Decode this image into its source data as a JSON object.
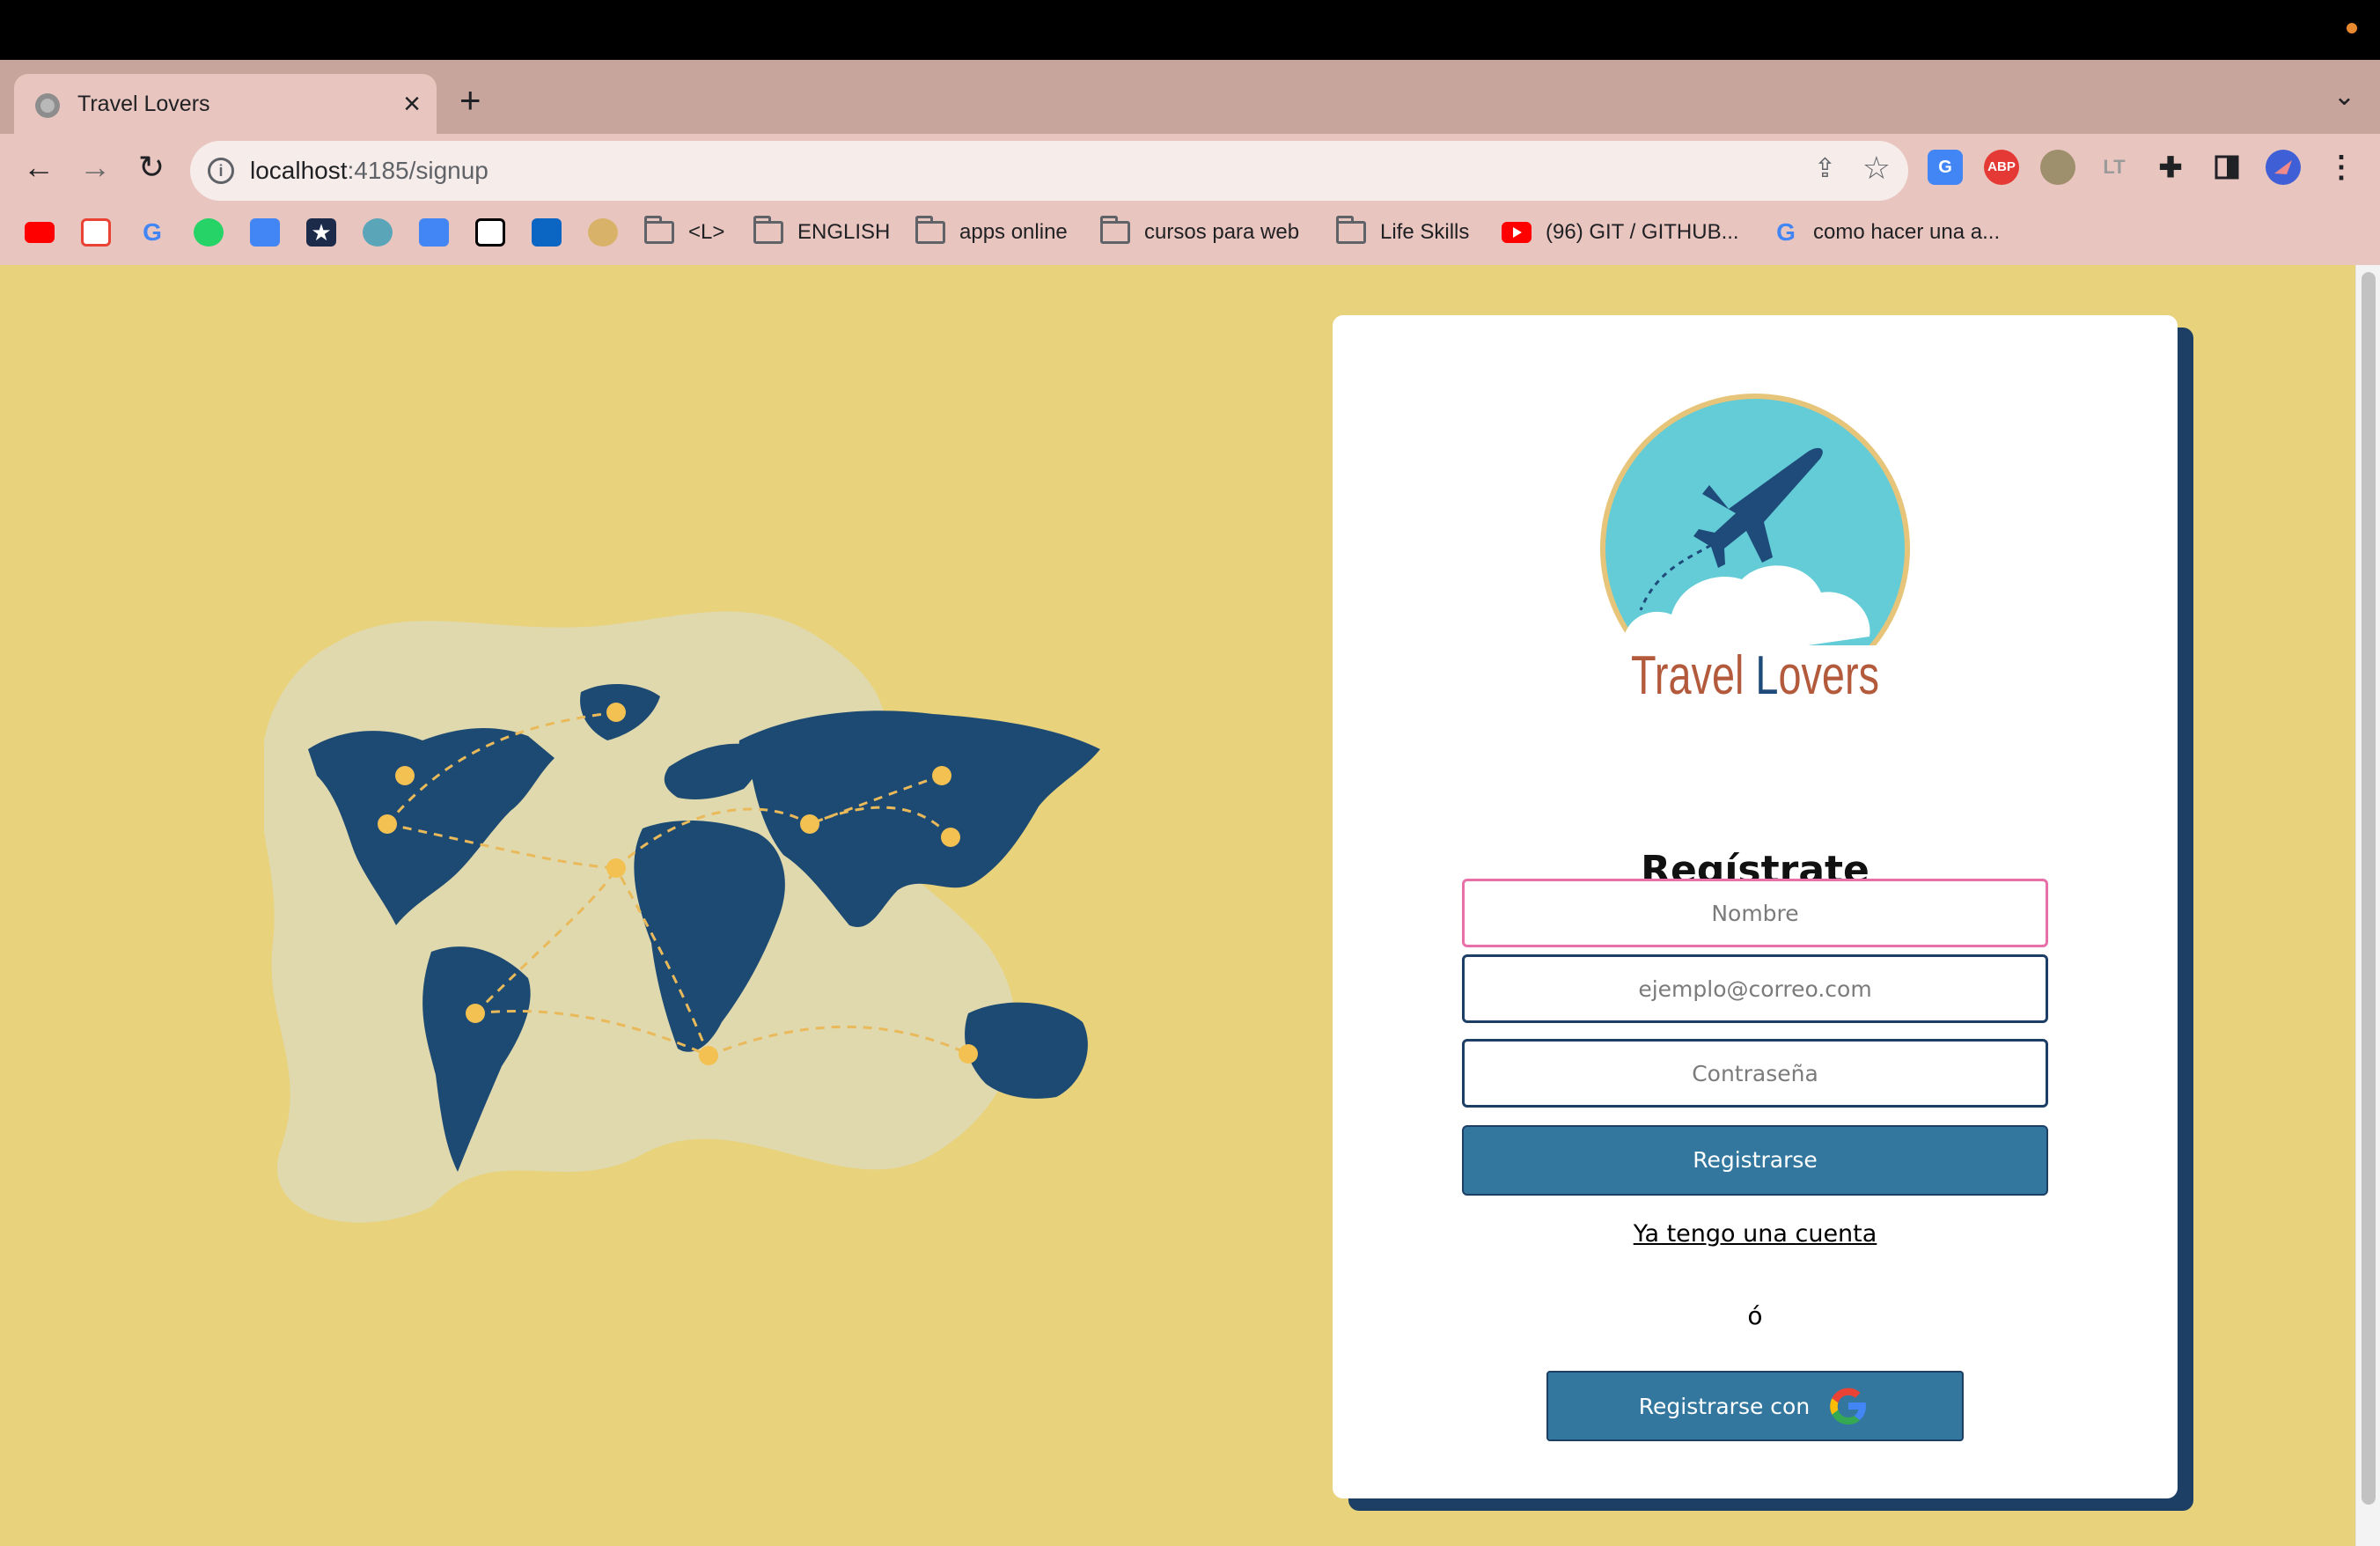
{
  "browser": {
    "tab_title": "Travel Lovers",
    "tab_close": "×",
    "new_tab": "+",
    "url_host": "localhost",
    "url_path": ":4185/signup",
    "bookmarks": [
      {
        "label": "<L>",
        "icon": "folder-icon"
      },
      {
        "label": "ENGLISH",
        "icon": "folder-icon"
      },
      {
        "label": "apps online",
        "icon": "folder-icon"
      },
      {
        "label": "cursos para web",
        "icon": "folder-icon"
      },
      {
        "label": "Life Skills",
        "icon": "folder-icon"
      },
      {
        "label": "(96) GIT / GITHUB...",
        "icon": "youtube-icon"
      },
      {
        "label": "como hacer una a...",
        "icon": "google-icon"
      }
    ],
    "extensions": [
      "google-translate-icon",
      "adblock-plus-icon",
      "owl-extension-icon",
      "languagetool-icon",
      "puzzle-extensions-icon",
      "side-panel-icon",
      "profile-avatar-icon"
    ],
    "ext_labels": {
      "abp": "ABP",
      "translate": "G",
      "lt": "LT"
    }
  },
  "logo": {
    "brand_text_1": "Travel ",
    "brand_text_2": "L",
    "brand_text_3": "overs"
  },
  "signup": {
    "title": "Regístrate",
    "name_placeholder": "Nombre",
    "email_placeholder": "ejemplo@correo.com",
    "password_placeholder": "Contraseña",
    "submit_label": "Registrarse",
    "login_link": "Ya tengo una cuenta",
    "or_text": "ó",
    "google_label": "Registrarse con"
  },
  "colors": {
    "page_bg": "#e8d27c",
    "map_land": "#1d4a73",
    "map_blob": "#e0d9ae",
    "button": "#33779f",
    "shadow": "#1d3f66",
    "focus_border": "#e86fa8",
    "logo_sky": "#63ccd6",
    "logo_ring": "#e6c47a",
    "logo_text": "#b35a3c"
  }
}
